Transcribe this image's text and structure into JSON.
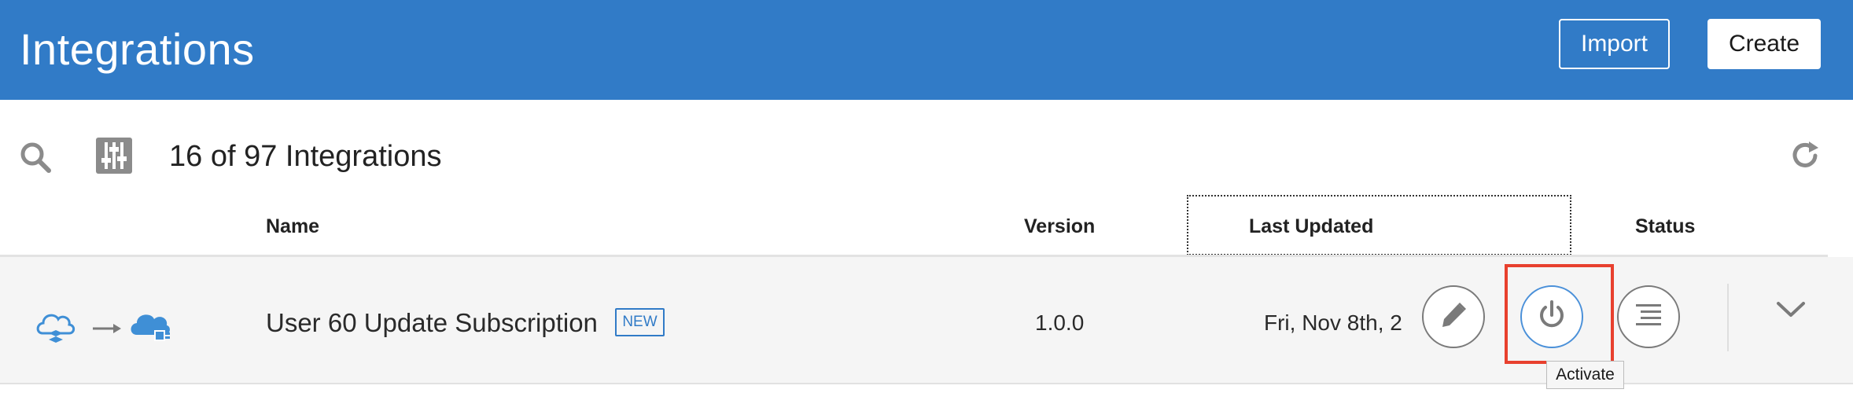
{
  "header": {
    "title": "Integrations",
    "import_label": "Import",
    "create_label": "Create",
    "brand_color": "#317bc7"
  },
  "toolbar": {
    "count_text": "16 of 97 Integrations",
    "icons": [
      "search-icon",
      "filter-sliders-icon",
      "refresh-icon"
    ]
  },
  "table": {
    "columns": [
      "Name",
      "Version",
      "Last Updated",
      "Status"
    ],
    "sorted_column": "Last Updated",
    "rows": [
      {
        "name": "User 60 Update Subscription",
        "badge": "NEW",
        "version": "1.0.0",
        "last_updated": "Fri, Nov 8th, 2",
        "source_icon": "cloud-app-icon",
        "target_icon": "cloud-adapter-icon",
        "actions": [
          "edit-icon",
          "power-icon",
          "detail-list-icon"
        ]
      }
    ]
  },
  "tooltip": {
    "text": "Activate"
  },
  "highlight_color": "#e8402e"
}
